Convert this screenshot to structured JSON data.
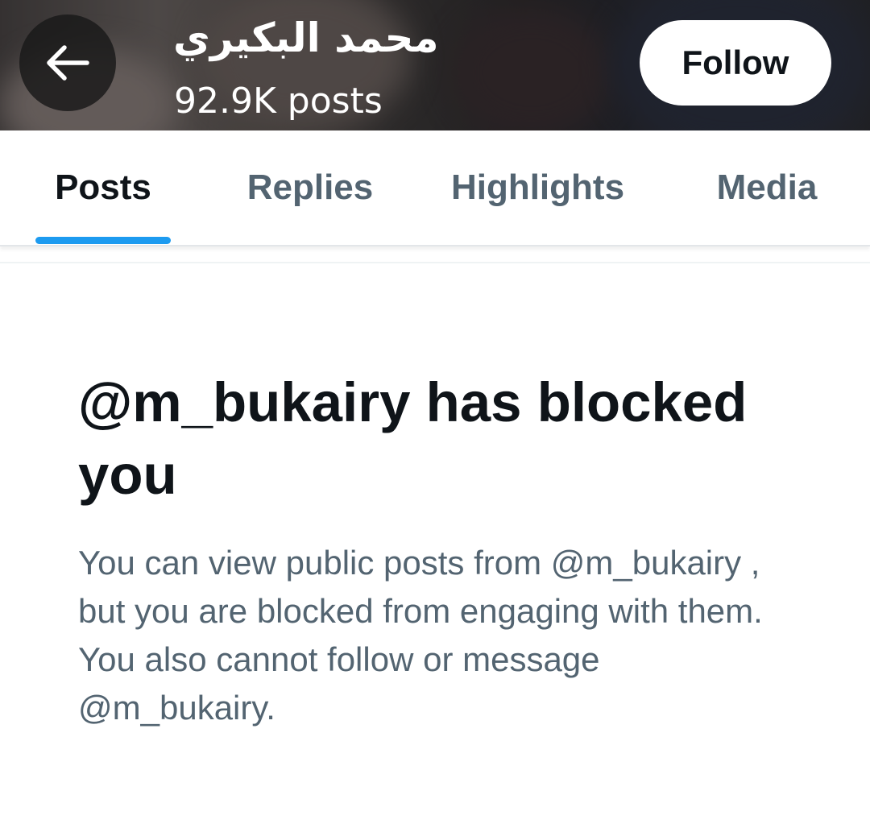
{
  "header": {
    "name": "محمد البكيري",
    "posts_count": "92.9K posts",
    "follow_label": "Follow",
    "back_icon": "arrow-left-icon"
  },
  "tabs": [
    {
      "label": "Posts",
      "active": true
    },
    {
      "label": "Replies",
      "active": false
    },
    {
      "label": "Highlights",
      "active": false
    },
    {
      "label": "Media",
      "active": false
    }
  ],
  "blocked": {
    "title": "@m_bukairy has blocked you",
    "message": "You can view public posts from @m_bukairy , but you are blocked from engaging with them. You also cannot follow or message @m_bukairy."
  },
  "colors": {
    "accent": "#1d9bf0",
    "text_primary": "#0f1419",
    "text_secondary": "#536471"
  }
}
